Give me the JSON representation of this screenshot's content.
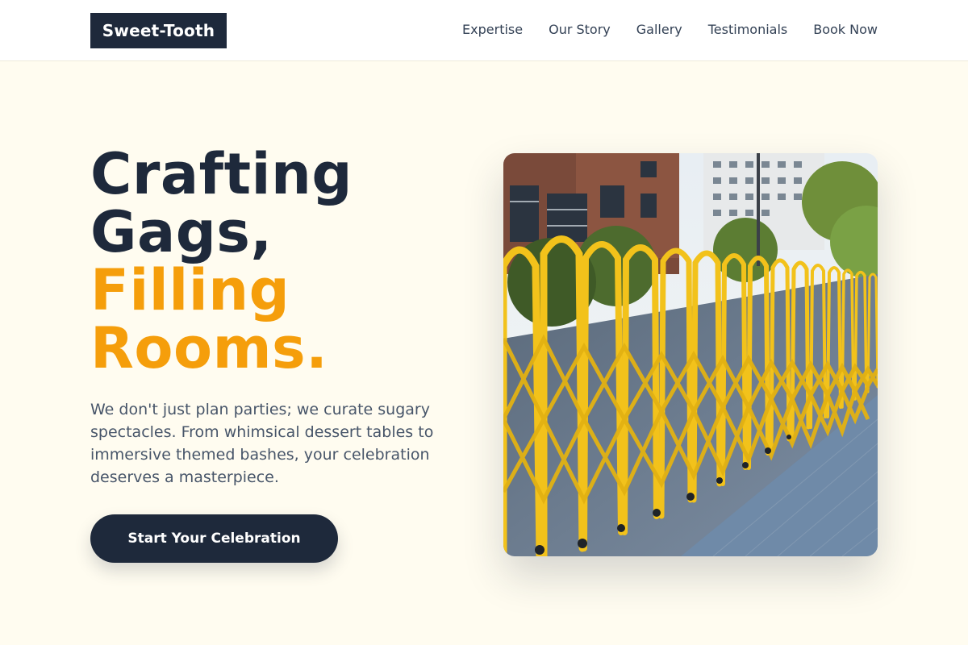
{
  "brand": {
    "name": "Sweet-Tooth"
  },
  "nav": {
    "items": [
      {
        "label": "Expertise"
      },
      {
        "label": "Our Story"
      },
      {
        "label": "Gallery"
      },
      {
        "label": "Testimonials"
      },
      {
        "label": "Book Now"
      }
    ]
  },
  "hero": {
    "title_line1": "Crafting",
    "title_line2": "Gags,",
    "title_line3": "Filling",
    "title_line4": "Rooms.",
    "description": "We don't just plan parties; we curate sugary spectacles. From whimsical dessert tables to immersive themed bashes, your celebration deserves a masterpiece.",
    "cta_label": "Start Your Celebration"
  },
  "image": {
    "subject": "yellow folding barrier fence on city sidewalk"
  },
  "colors": {
    "brand_dark": "#1e293b",
    "accent": "#f59e0b",
    "background": "#fffcf0"
  }
}
